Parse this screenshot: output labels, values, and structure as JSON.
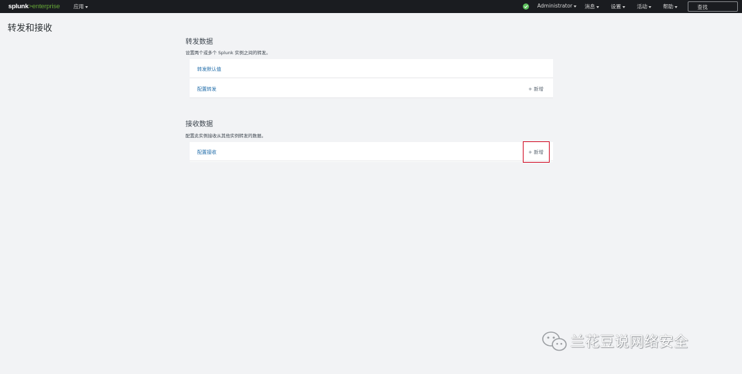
{
  "topbar": {
    "logo_main": "splunk",
    "logo_sep": ">",
    "logo_product": "enterprise",
    "apps_label": "应用",
    "user_label": "Administrator",
    "messages_label": "消息",
    "settings_label": "设置",
    "activity_label": "活动",
    "help_label": "帮助",
    "search_label": "查找",
    "status_color": "#5cc05c"
  },
  "page": {
    "title": "转发和接收"
  },
  "forwarding": {
    "title": "转发数据",
    "description": "设置两个或多个 Splunk 实例之间的转发。",
    "rows": [
      {
        "label": "转发默认值",
        "action": ""
      },
      {
        "label": "配置转发",
        "action": "+ 新增"
      }
    ]
  },
  "receiving": {
    "title": "接收数据",
    "description": "配置此实例接收从其他实例转发的数据。",
    "rows": [
      {
        "label": "配置接收",
        "action": "+ 新增"
      }
    ]
  },
  "watermark": {
    "text": "兰花豆说网络安全",
    "icon": "wechat-icon"
  },
  "colors": {
    "link": "#1e6ba8",
    "highlight": "#d0021b",
    "topbar_bg": "#1a1c20"
  }
}
